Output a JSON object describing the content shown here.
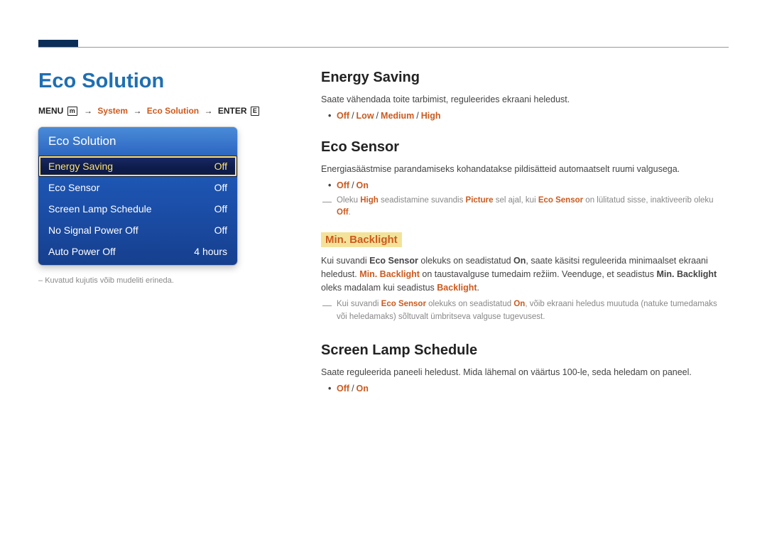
{
  "page": {
    "title": "Eco Solution",
    "caption": "Kuvatud kujutis võib mudeliti erineda."
  },
  "breadcrumb": {
    "menu_label": "MENU",
    "menu_icon": "m",
    "step1": "System",
    "step2": "Eco Solution",
    "enter_label": "ENTER",
    "enter_icon": "E"
  },
  "osd": {
    "header": "Eco Solution",
    "rows": [
      {
        "label": "Energy Saving",
        "value": "Off",
        "selected": true
      },
      {
        "label": "Eco Sensor",
        "value": "Off",
        "selected": false
      },
      {
        "label": "Screen Lamp Schedule",
        "value": "Off",
        "selected": false
      },
      {
        "label": "No Signal Power Off",
        "value": "Off",
        "selected": false
      },
      {
        "label": "Auto Power Off",
        "value": "4 hours",
        "selected": false
      }
    ]
  },
  "sections": {
    "energy_saving": {
      "heading": "Energy Saving",
      "desc": "Saate vähendada toite tarbimist, reguleerides ekraani heledust.",
      "options": [
        "Off",
        "Low",
        "Medium",
        "High"
      ]
    },
    "eco_sensor": {
      "heading": "Eco Sensor",
      "desc": "Energiasäästmise parandamiseks kohandatakse pildisätteid automaatselt ruumi valgusega.",
      "options": [
        "Off",
        "On"
      ],
      "note1_parts": {
        "p1": "Oleku ",
        "k1": "High",
        "p2": " seadistamine suvandis ",
        "k2": "Picture",
        "p3": " sel ajal, kui ",
        "k3": "Eco Sensor",
        "p4": " on lülitatud sisse, inaktiveerib oleku ",
        "k4": "Off",
        "p5": "."
      },
      "sub": {
        "heading": "Min. Backlight",
        "desc_parts": {
          "p1": "Kui suvandi ",
          "k1": "Eco Sensor",
          "p2": " olekuks on seadistatud ",
          "k2": "On",
          "p3": ", saate käsitsi reguleerida minimaalset ekraani heledust. ",
          "k3": "Min. Backlight",
          "p4": " on taustavalguse tumedaim režiim. Veenduge, et seadistus ",
          "k4": "Min. Backlight",
          "p5": " oleks madalam kui seadistus ",
          "k5": "Backlight",
          "p6": "."
        },
        "note_parts": {
          "p1": "Kui suvandi ",
          "k1": "Eco Sensor",
          "p2": " olekuks on seadistatud ",
          "k2": "On",
          "p3": ", võib ekraani heledus muutuda (natuke tumedamaks või heledamaks) sõltuvalt ümbritseva valguse tugevusest."
        }
      }
    },
    "screen_lamp": {
      "heading": "Screen Lamp Schedule",
      "desc": "Saate reguleerida paneeli heledust. Mida lähemal on väärtus 100-le, seda heledam on paneel.",
      "options": [
        "Off",
        "On"
      ]
    }
  }
}
